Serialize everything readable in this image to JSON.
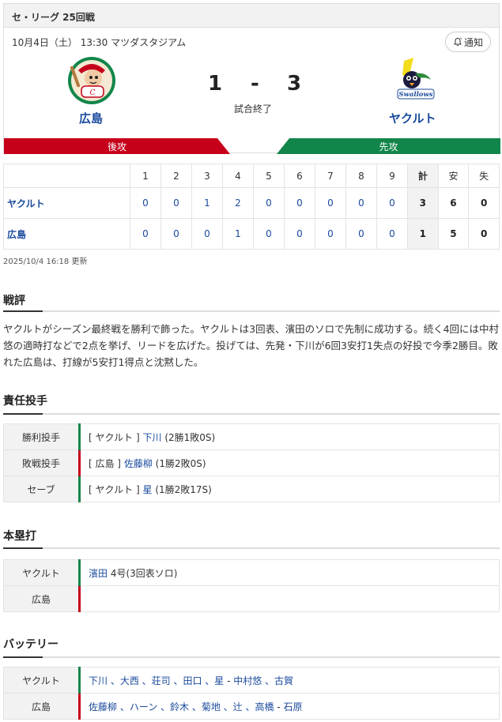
{
  "header": {
    "league": "セ・リーグ 25回戦",
    "info": "10月4日（土） 13:30 マツダスタジアム",
    "notify_label": "通知"
  },
  "home": {
    "name": "広島",
    "score": "1",
    "side": "後攻"
  },
  "away": {
    "name": "ヤクルト",
    "score": "3",
    "side": "先攻"
  },
  "separator": "-",
  "status": "試合終了",
  "colors": {
    "carp_red": "#c6001a",
    "swallows_green": "#12864a",
    "link": "#1a4a9c"
  },
  "scoreboard": {
    "headers": [
      "1",
      "2",
      "3",
      "4",
      "5",
      "6",
      "7",
      "8",
      "9",
      "計",
      "安",
      "失"
    ],
    "rows": [
      {
        "team": "ヤクルト",
        "innings": [
          "0",
          "0",
          "1",
          "2",
          "0",
          "0",
          "0",
          "0",
          "0"
        ],
        "total": "3",
        "hits": "6",
        "errors": "0"
      },
      {
        "team": "広島",
        "innings": [
          "0",
          "0",
          "0",
          "1",
          "0",
          "0",
          "0",
          "0",
          "0"
        ],
        "total": "1",
        "hits": "5",
        "errors": "0"
      }
    ],
    "updated": "2025/10/4 16:18 更新"
  },
  "review": {
    "title": "戦評",
    "text": "ヤクルトがシーズン最終戦を勝利で飾った。ヤクルトは3回表、濱田のソロで先制に成功する。続く4回には中村悠の適時打などで2点を挙げ、リードを広げた。投げては、先発・下川が6回3安打1失点の好投で今季2勝目。敗れた広島は、打線が5安打1得点と沈黙した。"
  },
  "pitchers": {
    "title": "責任投手",
    "rows": [
      {
        "label": "勝利投手",
        "team": "[ ヤクルト ]",
        "player": "下川",
        "record": "(2勝1敗0S)"
      },
      {
        "label": "敗戦投手",
        "team": "[ 広島 ]",
        "player": "佐藤柳",
        "record": "(1勝2敗0S)"
      },
      {
        "label": "セーブ",
        "team": "[ ヤクルト ]",
        "player": "星",
        "record": "(1勝2敗17S)"
      }
    ]
  },
  "homeruns": {
    "title": "本塁打",
    "rows": [
      {
        "label": "ヤクルト",
        "player": "濱田",
        "detail": "4号(3回表ソロ)"
      },
      {
        "label": "広島",
        "player": "",
        "detail": ""
      }
    ]
  },
  "battery": {
    "title": "バッテリー",
    "rows": [
      {
        "label": "ヤクルト",
        "pitchers": "下川 、大西 、荘司 、田口 、星",
        "catchers": "中村悠 、古賀"
      },
      {
        "label": "広島",
        "pitchers": "佐藤柳 、ハーン 、鈴木 、菊地 、辻 、高橋",
        "catchers": "石原"
      }
    ],
    "sep": " - "
  },
  "icons": {
    "notify": "bell-icon",
    "home_logo": "carp-logo-icon",
    "away_logo": "swallows-logo-icon"
  }
}
